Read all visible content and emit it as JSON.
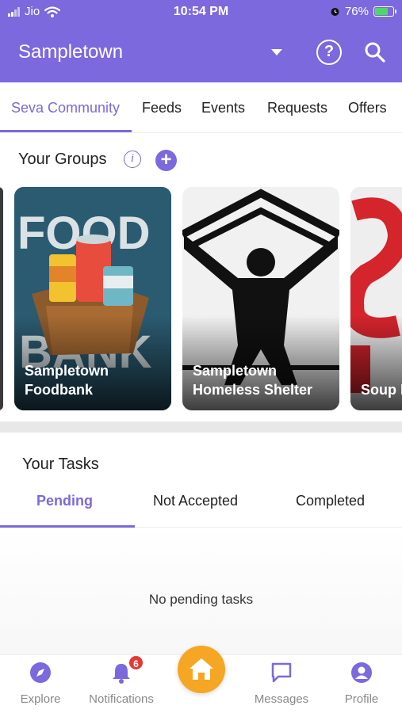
{
  "status_bar": {
    "carrier": "Jio",
    "time": "10:54 PM",
    "battery": "76%",
    "battery_level": 0.76
  },
  "header": {
    "location": "Sampletown",
    "icons": [
      "chevron-down-icon",
      "help-icon",
      "search-icon"
    ]
  },
  "tabs": [
    {
      "label": "Seva Community",
      "active": true
    },
    {
      "label": "Feeds",
      "active": false
    },
    {
      "label": "Events",
      "active": false
    },
    {
      "label": "Requests",
      "active": false
    },
    {
      "label": "Offers",
      "active": false
    }
  ],
  "groups": {
    "title": "Your Groups",
    "info_icon_glyph": "i",
    "add_icon_glyph": "+",
    "cards": [
      {
        "line1": "Sampletown",
        "line2": "Foodbank",
        "image_text_top": "FOOD",
        "image_text_bottom": "BANK"
      },
      {
        "line1": "Sampletown",
        "line2": "Homeless Shelter"
      },
      {
        "line1": "",
        "line2": "Soup K"
      }
    ]
  },
  "tasks": {
    "title": "Your Tasks",
    "tabs": [
      {
        "label": "Pending",
        "active": true
      },
      {
        "label": "Not Accepted",
        "active": false
      },
      {
        "label": "Completed",
        "active": false
      }
    ],
    "empty_message": "No pending tasks"
  },
  "bottom_nav": {
    "items": [
      {
        "label": "Explore",
        "icon": "compass-icon"
      },
      {
        "label": "Notifications",
        "icon": "bell-icon",
        "badge": "6"
      },
      {
        "label": "",
        "icon": "home-icon"
      },
      {
        "label": "Messages",
        "icon": "chat-icon"
      },
      {
        "label": "Profile",
        "icon": "profile-icon"
      }
    ]
  },
  "colors": {
    "primary": "#7b69dd",
    "home_button": "#f5a623",
    "badge": "#e53935",
    "nav_icon": "#7b69dd"
  }
}
